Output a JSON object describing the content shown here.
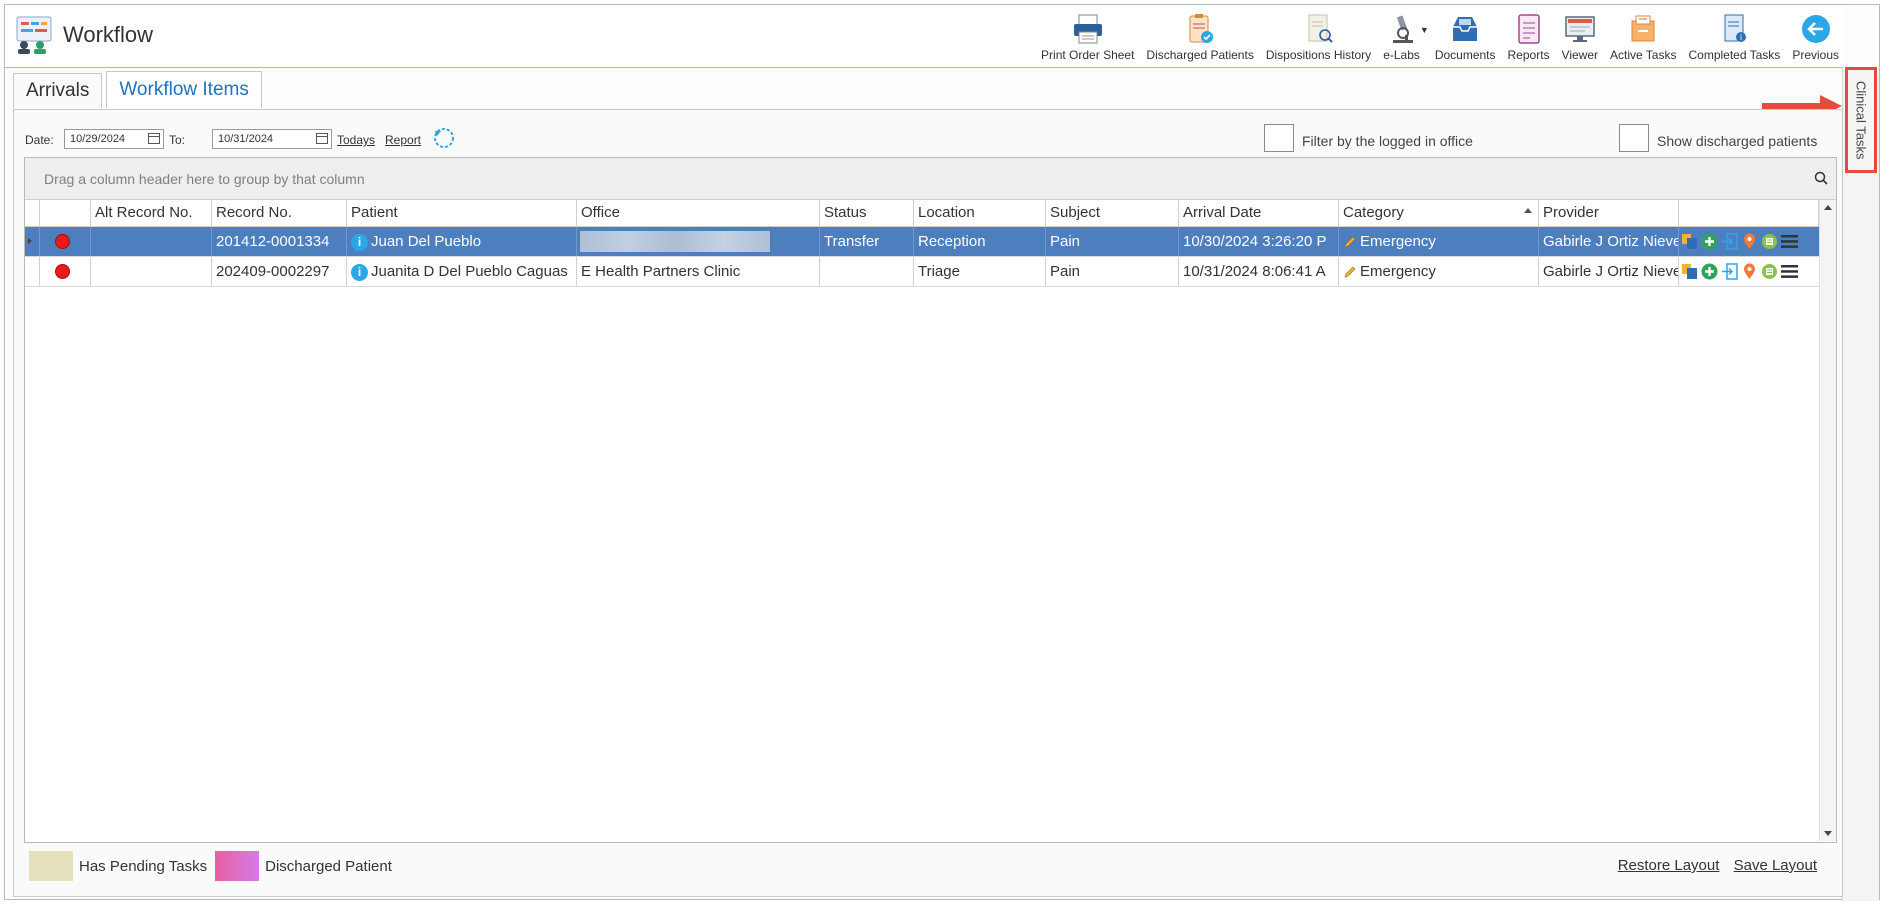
{
  "app": {
    "title": "Workflow"
  },
  "toolbar": [
    {
      "label": "Print Order Sheet",
      "icon": "printer-icon"
    },
    {
      "label": "Discharged Patients",
      "icon": "clipboard-check-icon"
    },
    {
      "label": "Dispositions History",
      "icon": "document-search-icon"
    },
    {
      "label": "e-Labs",
      "icon": "microscope-icon"
    },
    {
      "label": "Documents",
      "icon": "inbox-tray-icon"
    },
    {
      "label": "Reports",
      "icon": "report-icon"
    },
    {
      "label": "Viewer",
      "icon": "monitor-icon"
    },
    {
      "label": "Active Tasks",
      "icon": "task-box-icon"
    },
    {
      "label": "Completed Tasks",
      "icon": "completed-doc-icon"
    },
    {
      "label": "Previous",
      "icon": "back-arrow-icon"
    }
  ],
  "side_tab": {
    "label": "Clinical Tasks"
  },
  "tabs": [
    {
      "label": "Arrivals"
    },
    {
      "label": "Workflow Items"
    }
  ],
  "filters": {
    "date_label": "Date:",
    "date_from": "10/29/2024",
    "to_label": "To:",
    "date_to": "10/31/2024",
    "todays_link": "Todays",
    "report_link": "Report",
    "filter_office_label": "Filter by the logged in office",
    "show_discharged_label": "Show discharged patients"
  },
  "grid": {
    "group_panel_text": "Drag a column header here to group by that column",
    "columns": [
      "Alt Record No.",
      "Record No.",
      "Patient",
      "Office",
      "Status",
      "Location",
      "Subject",
      "Arrival Date",
      "Category",
      "Provider"
    ],
    "rows": [
      {
        "alt_record": "",
        "record_no": "201412-0001334",
        "patient": "Juan Del Pueblo",
        "office": "",
        "status": "Transfer",
        "location": "Reception",
        "subject": "Pain",
        "arrival_date": "10/30/2024 3:26:20 P",
        "category": "Emergency",
        "provider": "Gabirle J Ortiz Nieve"
      },
      {
        "alt_record": "",
        "record_no": "202409-0002297",
        "patient": "Juanita D Del Pueblo Caguas",
        "office": "E Health Partners Clinic",
        "status": "",
        "location": "Triage",
        "subject": "Pain",
        "arrival_date": "10/31/2024 8:06:41 A",
        "category": "Emergency",
        "provider": "Gabirle J Ortiz Nieve"
      }
    ]
  },
  "legend": [
    {
      "label": "Has Pending Tasks",
      "color": "#e6e1bd"
    },
    {
      "label": "Discharged Patient",
      "color": "#e764b5"
    }
  ],
  "footer": {
    "restore_layout": "Restore Layout",
    "save_layout": "Save Layout"
  },
  "colors": {
    "selected_row": "#4d7fbf",
    "accent": "#1e73be",
    "highlight_border": "#e34c3c"
  }
}
